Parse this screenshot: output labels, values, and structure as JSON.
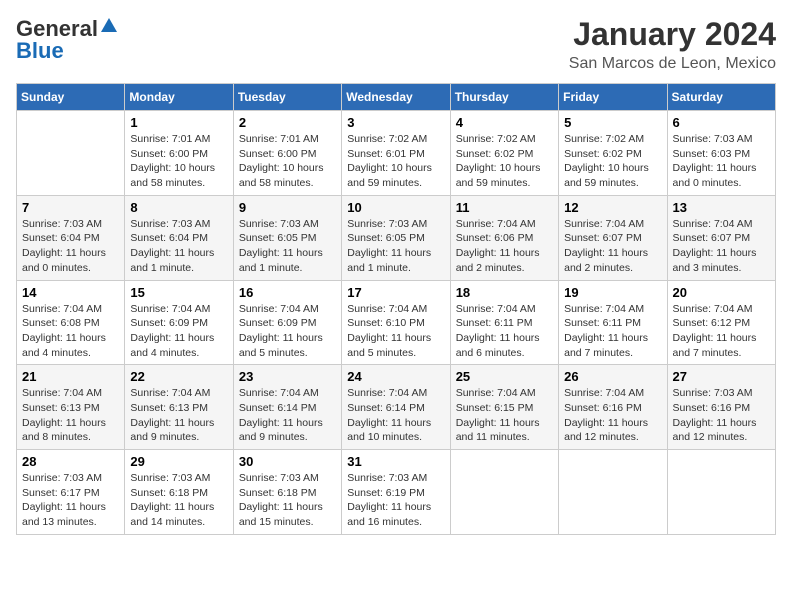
{
  "header": {
    "logo_general": "General",
    "logo_blue": "Blue",
    "month": "January 2024",
    "location": "San Marcos de Leon, Mexico"
  },
  "days_of_week": [
    "Sunday",
    "Monday",
    "Tuesday",
    "Wednesday",
    "Thursday",
    "Friday",
    "Saturday"
  ],
  "weeks": [
    [
      {
        "day": "",
        "info": ""
      },
      {
        "day": "1",
        "info": "Sunrise: 7:01 AM\nSunset: 6:00 PM\nDaylight: 10 hours\nand 58 minutes."
      },
      {
        "day": "2",
        "info": "Sunrise: 7:01 AM\nSunset: 6:00 PM\nDaylight: 10 hours\nand 58 minutes."
      },
      {
        "day": "3",
        "info": "Sunrise: 7:02 AM\nSunset: 6:01 PM\nDaylight: 10 hours\nand 59 minutes."
      },
      {
        "day": "4",
        "info": "Sunrise: 7:02 AM\nSunset: 6:02 PM\nDaylight: 10 hours\nand 59 minutes."
      },
      {
        "day": "5",
        "info": "Sunrise: 7:02 AM\nSunset: 6:02 PM\nDaylight: 10 hours\nand 59 minutes."
      },
      {
        "day": "6",
        "info": "Sunrise: 7:03 AM\nSunset: 6:03 PM\nDaylight: 11 hours\nand 0 minutes."
      }
    ],
    [
      {
        "day": "7",
        "info": "Sunrise: 7:03 AM\nSunset: 6:04 PM\nDaylight: 11 hours\nand 0 minutes."
      },
      {
        "day": "8",
        "info": "Sunrise: 7:03 AM\nSunset: 6:04 PM\nDaylight: 11 hours\nand 1 minute."
      },
      {
        "day": "9",
        "info": "Sunrise: 7:03 AM\nSunset: 6:05 PM\nDaylight: 11 hours\nand 1 minute."
      },
      {
        "day": "10",
        "info": "Sunrise: 7:03 AM\nSunset: 6:05 PM\nDaylight: 11 hours\nand 1 minute."
      },
      {
        "day": "11",
        "info": "Sunrise: 7:04 AM\nSunset: 6:06 PM\nDaylight: 11 hours\nand 2 minutes."
      },
      {
        "day": "12",
        "info": "Sunrise: 7:04 AM\nSunset: 6:07 PM\nDaylight: 11 hours\nand 2 minutes."
      },
      {
        "day": "13",
        "info": "Sunrise: 7:04 AM\nSunset: 6:07 PM\nDaylight: 11 hours\nand 3 minutes."
      }
    ],
    [
      {
        "day": "14",
        "info": "Sunrise: 7:04 AM\nSunset: 6:08 PM\nDaylight: 11 hours\nand 4 minutes."
      },
      {
        "day": "15",
        "info": "Sunrise: 7:04 AM\nSunset: 6:09 PM\nDaylight: 11 hours\nand 4 minutes."
      },
      {
        "day": "16",
        "info": "Sunrise: 7:04 AM\nSunset: 6:09 PM\nDaylight: 11 hours\nand 5 minutes."
      },
      {
        "day": "17",
        "info": "Sunrise: 7:04 AM\nSunset: 6:10 PM\nDaylight: 11 hours\nand 5 minutes."
      },
      {
        "day": "18",
        "info": "Sunrise: 7:04 AM\nSunset: 6:11 PM\nDaylight: 11 hours\nand 6 minutes."
      },
      {
        "day": "19",
        "info": "Sunrise: 7:04 AM\nSunset: 6:11 PM\nDaylight: 11 hours\nand 7 minutes."
      },
      {
        "day": "20",
        "info": "Sunrise: 7:04 AM\nSunset: 6:12 PM\nDaylight: 11 hours\nand 7 minutes."
      }
    ],
    [
      {
        "day": "21",
        "info": "Sunrise: 7:04 AM\nSunset: 6:13 PM\nDaylight: 11 hours\nand 8 minutes."
      },
      {
        "day": "22",
        "info": "Sunrise: 7:04 AM\nSunset: 6:13 PM\nDaylight: 11 hours\nand 9 minutes."
      },
      {
        "day": "23",
        "info": "Sunrise: 7:04 AM\nSunset: 6:14 PM\nDaylight: 11 hours\nand 9 minutes."
      },
      {
        "day": "24",
        "info": "Sunrise: 7:04 AM\nSunset: 6:14 PM\nDaylight: 11 hours\nand 10 minutes."
      },
      {
        "day": "25",
        "info": "Sunrise: 7:04 AM\nSunset: 6:15 PM\nDaylight: 11 hours\nand 11 minutes."
      },
      {
        "day": "26",
        "info": "Sunrise: 7:04 AM\nSunset: 6:16 PM\nDaylight: 11 hours\nand 12 minutes."
      },
      {
        "day": "27",
        "info": "Sunrise: 7:03 AM\nSunset: 6:16 PM\nDaylight: 11 hours\nand 12 minutes."
      }
    ],
    [
      {
        "day": "28",
        "info": "Sunrise: 7:03 AM\nSunset: 6:17 PM\nDaylight: 11 hours\nand 13 minutes."
      },
      {
        "day": "29",
        "info": "Sunrise: 7:03 AM\nSunset: 6:18 PM\nDaylight: 11 hours\nand 14 minutes."
      },
      {
        "day": "30",
        "info": "Sunrise: 7:03 AM\nSunset: 6:18 PM\nDaylight: 11 hours\nand 15 minutes."
      },
      {
        "day": "31",
        "info": "Sunrise: 7:03 AM\nSunset: 6:19 PM\nDaylight: 11 hours\nand 16 minutes."
      },
      {
        "day": "",
        "info": ""
      },
      {
        "day": "",
        "info": ""
      },
      {
        "day": "",
        "info": ""
      }
    ]
  ]
}
